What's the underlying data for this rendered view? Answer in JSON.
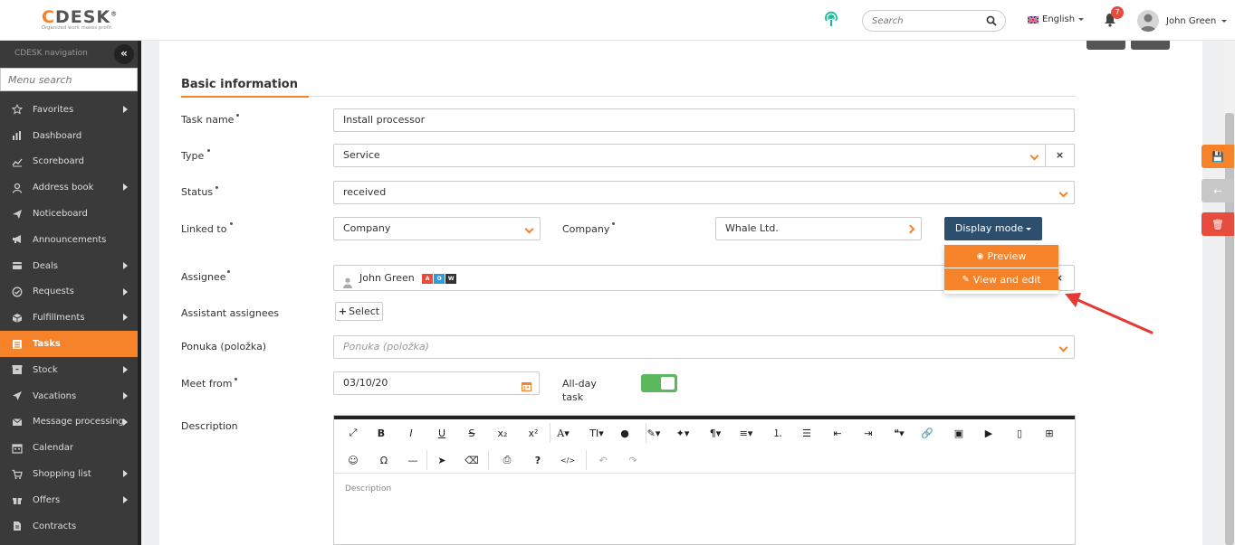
{
  "header": {
    "logo_c": "C",
    "logo_rest": "DESK",
    "logo_reg": "®",
    "logo_tagline": "Organized work makes profit",
    "search_placeholder": "Search",
    "language": "English",
    "notification_count": "7",
    "user_name": "John Green"
  },
  "sidebar": {
    "title": "CDESK navigation",
    "collapse_glyph": "«",
    "search_placeholder": "Menu search",
    "items": [
      {
        "label": "Favorites",
        "icon": "star-icon",
        "arrow": true
      },
      {
        "label": "Dashboard",
        "icon": "bar-chart-icon",
        "arrow": false
      },
      {
        "label": "Scoreboard",
        "icon": "line-chart-icon",
        "arrow": false
      },
      {
        "label": "Address book",
        "icon": "user-icon",
        "arrow": true
      },
      {
        "label": "Noticeboard",
        "icon": "paper-plane-icon",
        "arrow": false
      },
      {
        "label": "Announcements",
        "icon": "bullhorn-icon",
        "arrow": false
      },
      {
        "label": "Deals",
        "icon": "card-icon",
        "arrow": true
      },
      {
        "label": "Requests",
        "icon": "check-circle-icon",
        "arrow": true
      },
      {
        "label": "Fulfillments",
        "icon": "cube-icon",
        "arrow": true
      },
      {
        "label": "Tasks",
        "icon": "tasks-icon",
        "arrow": false,
        "active": true
      },
      {
        "label": "Stock",
        "icon": "box-icon",
        "arrow": true
      },
      {
        "label": "Vacations",
        "icon": "plane-icon",
        "arrow": true
      },
      {
        "label": "Message processing",
        "icon": "envelope-icon",
        "arrow": true
      },
      {
        "label": "Calendar",
        "icon": "calendar-icon",
        "arrow": false
      },
      {
        "label": "Shopping list",
        "icon": "cart-icon",
        "arrow": true
      },
      {
        "label": "Offers",
        "icon": "gift-icon",
        "arrow": true
      },
      {
        "label": "Contracts",
        "icon": "document-icon",
        "arrow": false
      }
    ]
  },
  "form": {
    "section_title": "Basic information",
    "task_name_label": "Task name",
    "task_name_value": "Install processor",
    "type_label": "Type",
    "type_value": "Service",
    "type_clear": "×",
    "status_label": "Status",
    "status_value": "received",
    "linked_label": "Linked to",
    "linked_value": "Company",
    "company_label": "Company",
    "company_value": "Whale Ltd.",
    "display_mode_label": "Display mode",
    "display_menu": {
      "preview": "Preview",
      "view_edit": "View and edit"
    },
    "assignee_label": "Assignee",
    "assignee_value": "John Green",
    "assignee_chips": [
      {
        "text": "A",
        "color": "#e74c3c"
      },
      {
        "text": "O",
        "color": "#3498db"
      },
      {
        "text": "W",
        "color": "#333333"
      }
    ],
    "assignee_clear": "×",
    "assistant_label": "Assistant assignees",
    "select_button": "Select",
    "ponuka_label": "Ponuka (položka)",
    "ponuka_placeholder": "Ponuka (položka)",
    "meet_label": "Meet from",
    "meet_value": "03/10/20",
    "allday_label_1": "All-day",
    "allday_label_2": "task",
    "allday_on": true,
    "description_label": "Description",
    "description_placeholder": "Description"
  },
  "editor_toolbar": {
    "row1": [
      {
        "name": "fullscreen-icon",
        "glyph": "⤢"
      },
      {
        "name": "bold-icon",
        "glyph": "B"
      },
      {
        "name": "italic-icon",
        "glyph": "I"
      },
      {
        "name": "underline-icon",
        "glyph": "U"
      },
      {
        "name": "strikethrough-icon",
        "glyph": "S"
      },
      {
        "name": "subscript-icon",
        "glyph": "x₂"
      },
      {
        "name": "superscript-icon",
        "glyph": "x²"
      },
      {
        "name": "font-family-icon",
        "glyph": "A▾"
      },
      {
        "name": "font-size-icon",
        "glyph": "TI▾"
      },
      {
        "name": "color-icon",
        "glyph": "●"
      },
      {
        "name": "paint-brush-icon",
        "glyph": "✎▾"
      },
      {
        "name": "magic-icon",
        "glyph": "✦▾"
      },
      {
        "name": "paragraph-icon",
        "glyph": "¶▾"
      },
      {
        "name": "align-icon",
        "glyph": "≡▾"
      },
      {
        "name": "ordered-list-icon",
        "glyph": "⒈"
      },
      {
        "name": "unordered-list-icon",
        "glyph": "☰"
      },
      {
        "name": "outdent-icon",
        "glyph": "⇤"
      },
      {
        "name": "indent-icon",
        "glyph": "⇥"
      },
      {
        "name": "quote-icon",
        "glyph": "❝▾"
      },
      {
        "name": "link-icon",
        "glyph": "🔗"
      },
      {
        "name": "image-icon",
        "glyph": "▣"
      },
      {
        "name": "video-icon",
        "glyph": "▶"
      },
      {
        "name": "file-icon",
        "glyph": "▯"
      },
      {
        "name": "table-icon",
        "glyph": "⊞"
      }
    ],
    "row2": [
      {
        "name": "emoticon-icon",
        "glyph": "☺"
      },
      {
        "name": "special-char-icon",
        "glyph": "Ω"
      },
      {
        "name": "horizontal-line-icon",
        "glyph": "—"
      },
      {
        "name": "select-all-icon",
        "glyph": "➤"
      },
      {
        "name": "clear-format-icon",
        "glyph": "⌫"
      },
      {
        "name": "print-icon",
        "glyph": "⎙"
      },
      {
        "name": "help-icon",
        "glyph": "?"
      },
      {
        "name": "code-view-icon",
        "glyph": "</>"
      },
      {
        "name": "undo-icon",
        "glyph": "↶"
      },
      {
        "name": "redo-icon",
        "glyph": "↷"
      }
    ]
  },
  "side_actions": [
    {
      "name": "save-icon",
      "glyph": "💾",
      "color": "#f6822a"
    },
    {
      "name": "back-arrow-icon",
      "glyph": "←",
      "color": "#c8c8c8"
    },
    {
      "name": "trash-icon",
      "glyph": "🗑",
      "color": "#e74c3c"
    }
  ],
  "colors": {
    "accent": "#f6822a",
    "sidebar": "#3a3a3a",
    "display_mode": "#2c4f6e",
    "toggle": "#5cb85c"
  }
}
